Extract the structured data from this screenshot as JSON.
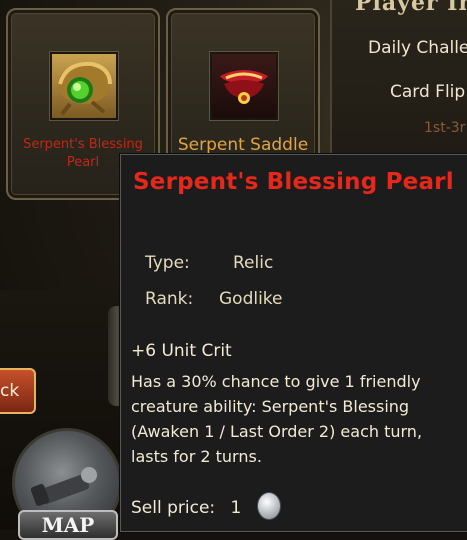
{
  "info_panel": {
    "title": "Player In",
    "lines": [
      "Daily Challe",
      "Card Flip",
      "1st-3r"
    ]
  },
  "inventory": {
    "items": [
      {
        "name": "Serpent's Blessing Pearl",
        "icon": "serpent-pearl-icon",
        "name_color": "#c0281a"
      },
      {
        "name": "Serpent Saddle",
        "icon": "serpent-saddle-icon",
        "name_color": "#e0a545"
      }
    ]
  },
  "left_controls": {
    "button_label": "ck",
    "map_label": "MAP"
  },
  "tooltip": {
    "title": "Serpent's Blessing Pearl",
    "title_color": "#e8271b",
    "type_label": "Type:",
    "type_value": "Relic",
    "rank_label": "Rank:",
    "rank_value": "Godlike",
    "stat": "+6 Unit Crit",
    "description": "Has a 30% chance to give 1 friendly creature ability: Serpent's Blessing (Awaken 1 / Last Order 2) each turn, lasts for 2 turns.",
    "sell_label": "Sell price:",
    "sell_value": "1",
    "currency_icon": "silver-coin-icon"
  }
}
